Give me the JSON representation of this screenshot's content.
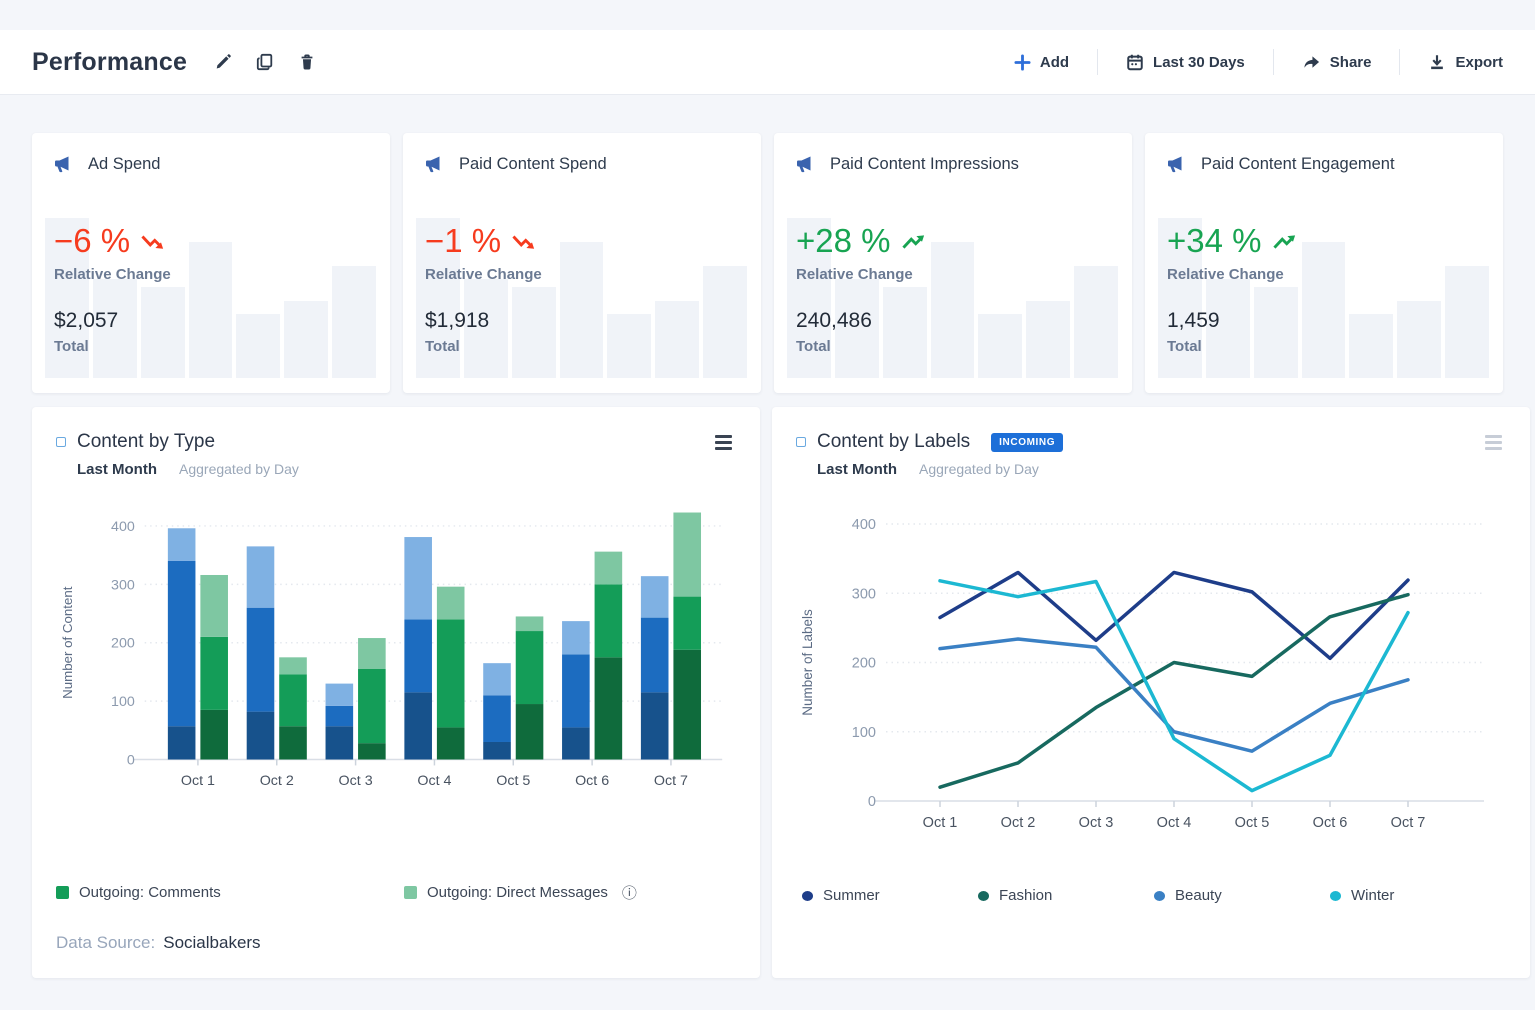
{
  "header": {
    "title": "Performance",
    "tools": [
      "edit",
      "duplicate",
      "delete"
    ],
    "actions": [
      {
        "label": "Add",
        "icon": "plus-icon"
      },
      {
        "label": "Last 30 Days",
        "icon": "calendar-icon"
      },
      {
        "label": "Share",
        "icon": "share-icon"
      },
      {
        "label": "Export",
        "icon": "download-icon"
      }
    ]
  },
  "kpi": {
    "relative_change_label": "Relative Change",
    "total_label": "Total",
    "colors": {
      "up": "#18a452",
      "down": "#f63b1e",
      "icon": "#3a63ae"
    },
    "sparkline": [
      1,
      0.62,
      0.57,
      0.85,
      0.4,
      0.48,
      0.7
    ],
    "cards": [
      {
        "title": "Ad Spend",
        "change": "−6 %",
        "direction": "down",
        "total": "$2,057"
      },
      {
        "title": "Paid Content Spend",
        "change": "−1 %",
        "direction": "down",
        "total": "$1,918"
      },
      {
        "title": "Paid Content Impressions",
        "change": "+28 %",
        "direction": "up",
        "total": "240,486"
      },
      {
        "title": "Paid Content Engagement",
        "change": "+34 %",
        "direction": "up",
        "total": "1,459"
      }
    ]
  },
  "content_by_type": {
    "title": "Content by Type",
    "period": "Last Month",
    "aggregation": "Aggregated by Day",
    "legend": [
      {
        "label": "Outgoing: Comments",
        "color": "#149d58"
      },
      {
        "label": "Outgoing: Direct Messages",
        "color": "#7ec7a2",
        "info": "ⓘ"
      }
    ],
    "data_source_label": "Data Source:",
    "data_source": "Socialbakers",
    "chart_data": {
      "type": "bar",
      "stacked": true,
      "categories": [
        "Oct 1",
        "Oct 2",
        "Oct 3",
        "Oct 4",
        "Oct 5",
        "Oct 6",
        "Oct 7"
      ],
      "ylabel": "Number of Content",
      "ylim": [
        0,
        400
      ],
      "yticks": [
        0,
        100,
        200,
        300,
        400
      ],
      "grid": "dotted-horizontal",
      "bar_stacks": [
        {
          "group": "outgoing-blue",
          "colors": [
            "#17528c",
            "#1c6cc0",
            "#7fb1e3"
          ],
          "values": [
            [
              57,
              283,
              56
            ],
            [
              82,
              178,
              105
            ],
            [
              57,
              35,
              38
            ],
            [
              115,
              125,
              141
            ],
            [
              30,
              80,
              55
            ],
            [
              55,
              125,
              57
            ],
            [
              115,
              128,
              71
            ]
          ]
        },
        {
          "group": "outgoing-green",
          "colors": [
            "#0f6b3c",
            "#149d58",
            "#7ec7a2"
          ],
          "values": [
            [
              85,
              125,
              106
            ],
            [
              57,
              89,
              29
            ],
            [
              28,
              127,
              53
            ],
            [
              55,
              185,
              56
            ],
            [
              95,
              125,
              25
            ],
            [
              175,
              125,
              56
            ],
            [
              188,
              91,
              144
            ]
          ]
        }
      ]
    }
  },
  "content_by_labels": {
    "title": "Content by Labels",
    "badge": "INCOMING",
    "period": "Last Month",
    "aggregation": "Aggregated by Day",
    "chart_data": {
      "type": "line",
      "categories": [
        "Oct 1",
        "Oct 2",
        "Oct 3",
        "Oct 4",
        "Oct 5",
        "Oct 6",
        "Oct 7"
      ],
      "ylabel": "Number of Labels",
      "ylim": [
        0,
        400
      ],
      "yticks": [
        0,
        100,
        200,
        300,
        400
      ],
      "grid": "dotted-horizontal",
      "legend_position": "bottom",
      "series": [
        {
          "name": "Summer",
          "color": "#1e3d89",
          "values": [
            265,
            330,
            232,
            330,
            302,
            206,
            319
          ]
        },
        {
          "name": "Fashion",
          "color": "#17695f",
          "values": [
            20,
            55,
            135,
            200,
            180,
            266,
            298
          ]
        },
        {
          "name": "Beauty",
          "color": "#3a80c4",
          "values": [
            220,
            234,
            222,
            100,
            72,
            141,
            175
          ]
        },
        {
          "name": "Winter",
          "color": "#1cb8d2",
          "values": [
            318,
            295,
            317,
            90,
            15,
            66,
            272
          ]
        }
      ]
    }
  }
}
